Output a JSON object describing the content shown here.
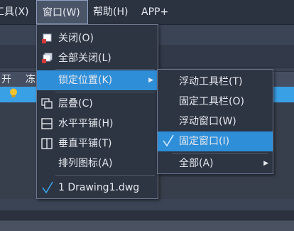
{
  "menubar": {
    "items": [
      {
        "label": "工具(X)"
      },
      {
        "label": "窗口(W)"
      },
      {
        "label": "帮助(H)"
      },
      {
        "label": "APP+"
      }
    ]
  },
  "layer_header": {
    "on_label": "开",
    "freeze_label": "冻"
  },
  "window_menu": {
    "items": [
      {
        "label": "关闭(O)",
        "icon": "close-window-icon"
      },
      {
        "label": "全部关闭(L)",
        "icon": "close-all-windows-icon"
      },
      {
        "label": "锁定位置(K)",
        "icon": "",
        "submenu": true
      },
      {
        "label": "层叠(C)",
        "icon": "cascade-icon"
      },
      {
        "label": "水平平铺(H)",
        "icon": "tile-horizontal-icon"
      },
      {
        "label": "垂直平铺(T)",
        "icon": "tile-vertical-icon"
      },
      {
        "label": "排列图标(A)",
        "icon": ""
      },
      {
        "label": "1 Drawing1.dwg",
        "icon": "checkmark-icon"
      }
    ]
  },
  "lock_submenu": {
    "items": [
      {
        "label": "浮动工具栏(T)"
      },
      {
        "label": "固定工具栏(O)"
      },
      {
        "label": "浮动窗口(W)"
      },
      {
        "label": "固定窗口(I)",
        "checked": true
      },
      {
        "label": "全部(A)",
        "submenu": true
      }
    ]
  },
  "colors": {
    "highlight": "#2f8ed8",
    "menu_bg": "#2d3442",
    "check": "#3aa0e6",
    "bulb": "#f4c430"
  }
}
